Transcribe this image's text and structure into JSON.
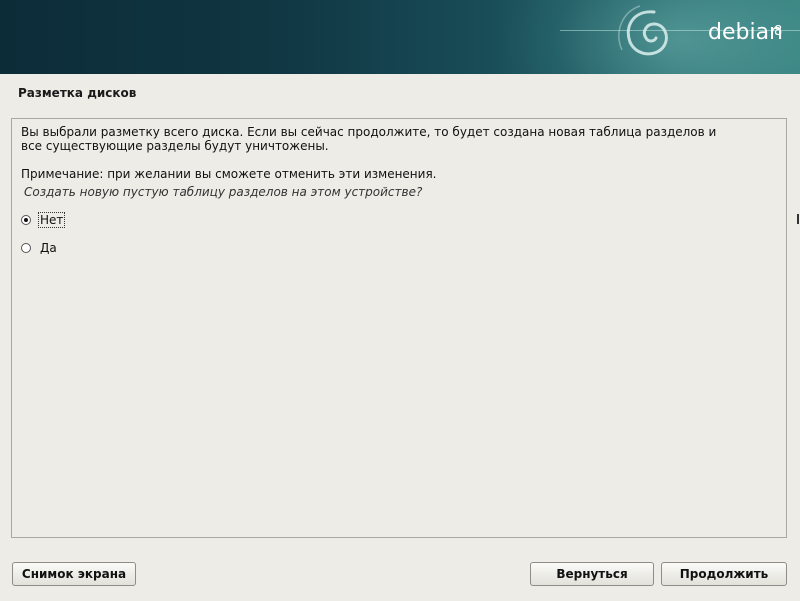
{
  "header": {
    "logo_text": "debian",
    "logo_version": "8",
    "logo_icon": "debian-swirl-icon"
  },
  "page": {
    "title": "Разметка дисков"
  },
  "dialog": {
    "message": "Вы выбрали разметку всего диска. Если вы сейчас продолжите, то будет создана новая таблица разделов и все существующие разделы будут уничтожены.",
    "note": "Примечание: при желании вы сможете отменить эти изменения.",
    "question": "Создать новую пустую таблицу разделов на этом устройстве?",
    "options": [
      {
        "label": "Нет",
        "selected": true
      },
      {
        "label": "Да",
        "selected": false
      }
    ]
  },
  "buttons": {
    "screenshot": "Снимок экрана",
    "back": "Вернуться",
    "continue": "Продолжить"
  }
}
